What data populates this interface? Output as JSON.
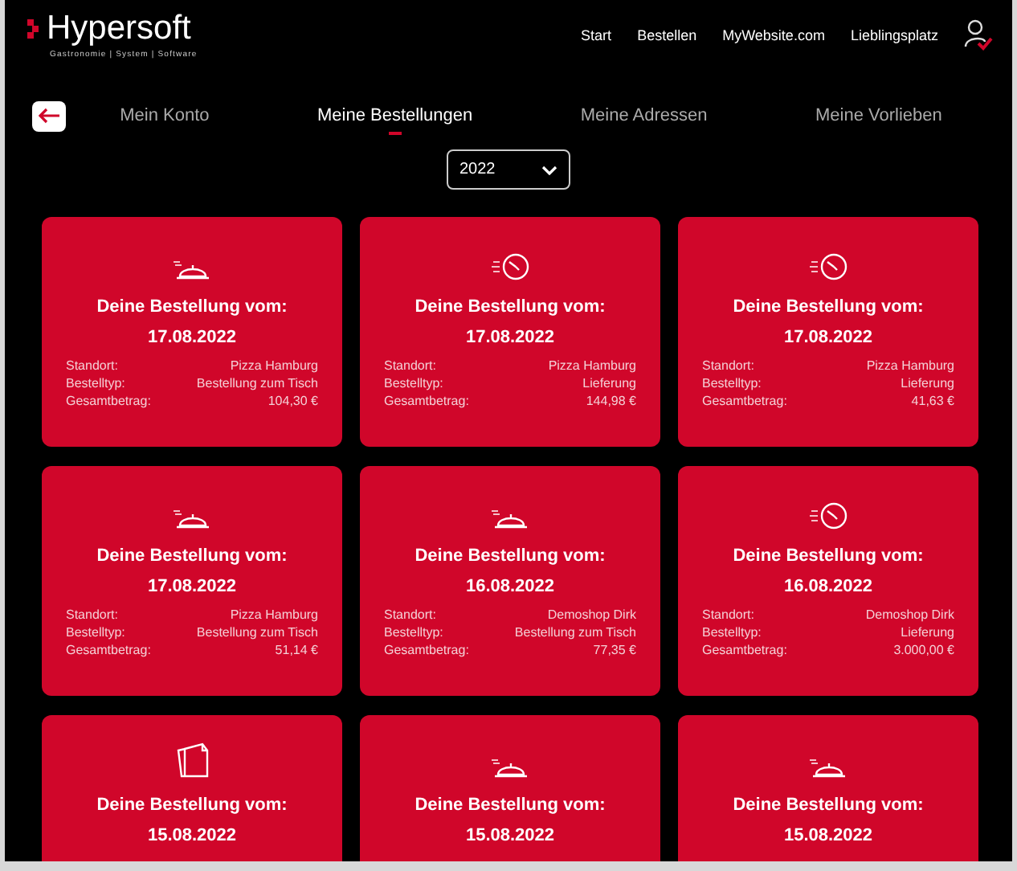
{
  "brand": {
    "name": "Hypersoft",
    "tagline": "Gastronomie | System | Software"
  },
  "nav": [
    "Start",
    "Bestellen",
    "MyWebsite.com",
    "Lieblingsplatz"
  ],
  "tabs": [
    {
      "label": "Mein Konto",
      "selected": false
    },
    {
      "label": "Meine Bestellungen",
      "selected": true
    },
    {
      "label": "Meine Adressen",
      "selected": false
    },
    {
      "label": "Meine Vorlieben",
      "selected": false
    }
  ],
  "year_select": {
    "value": "2022"
  },
  "orders": [
    {
      "kind": "table",
      "title": "Deine Bestellung vom:",
      "date": "17.08.2022",
      "details": [
        {
          "label": "Standort:",
          "value": "Pizza Hamburg"
        },
        {
          "label": "Bestelltyp:",
          "value": "Bestellung zum Tisch"
        },
        {
          "label": "Gesamtbetrag:",
          "value": "104,30 €"
        }
      ]
    },
    {
      "kind": "delivery",
      "title": "Deine Bestellung vom:",
      "date": "17.08.2022",
      "details": [
        {
          "label": "Standort:",
          "value": "Pizza Hamburg"
        },
        {
          "label": "Bestelltyp:",
          "value": "Lieferung"
        },
        {
          "label": "Gesamtbetrag:",
          "value": "144,98 €"
        }
      ]
    },
    {
      "kind": "delivery",
      "title": "Deine Bestellung vom:",
      "date": "17.08.2022",
      "details": [
        {
          "label": "Standort:",
          "value": "Pizza Hamburg"
        },
        {
          "label": "Bestelltyp:",
          "value": "Lieferung"
        },
        {
          "label": "Gesamtbetrag:",
          "value": "41,63 €"
        }
      ]
    },
    {
      "kind": "table",
      "title": "Deine Bestellung vom:",
      "date": "17.08.2022",
      "details": [
        {
          "label": "Standort:",
          "value": "Pizza Hamburg"
        },
        {
          "label": "Bestelltyp:",
          "value": "Bestellung zum Tisch"
        },
        {
          "label": "Gesamtbetrag:",
          "value": "51,14 €"
        }
      ]
    },
    {
      "kind": "table",
      "title": "Deine Bestellung vom:",
      "date": "16.08.2022",
      "details": [
        {
          "label": "Standort:",
          "value": "Demoshop Dirk"
        },
        {
          "label": "Bestelltyp:",
          "value": "Bestellung zum Tisch"
        },
        {
          "label": "Gesamtbetrag:",
          "value": "77,35 €"
        }
      ]
    },
    {
      "kind": "delivery",
      "title": "Deine Bestellung vom:",
      "date": "16.08.2022",
      "details": [
        {
          "label": "Standort:",
          "value": "Demoshop Dirk"
        },
        {
          "label": "Bestelltyp:",
          "value": "Lieferung"
        },
        {
          "label": "Gesamtbetrag:",
          "value": "3.000,00 €"
        }
      ]
    },
    {
      "kind": "pickup",
      "title": "Deine Bestellung vom:",
      "date": "15.08.2022"
    },
    {
      "kind": "table",
      "title": "Deine Bestellung vom:",
      "date": "15.08.2022"
    },
    {
      "kind": "table",
      "title": "Deine Bestellung vom:",
      "date": "15.08.2022"
    }
  ]
}
